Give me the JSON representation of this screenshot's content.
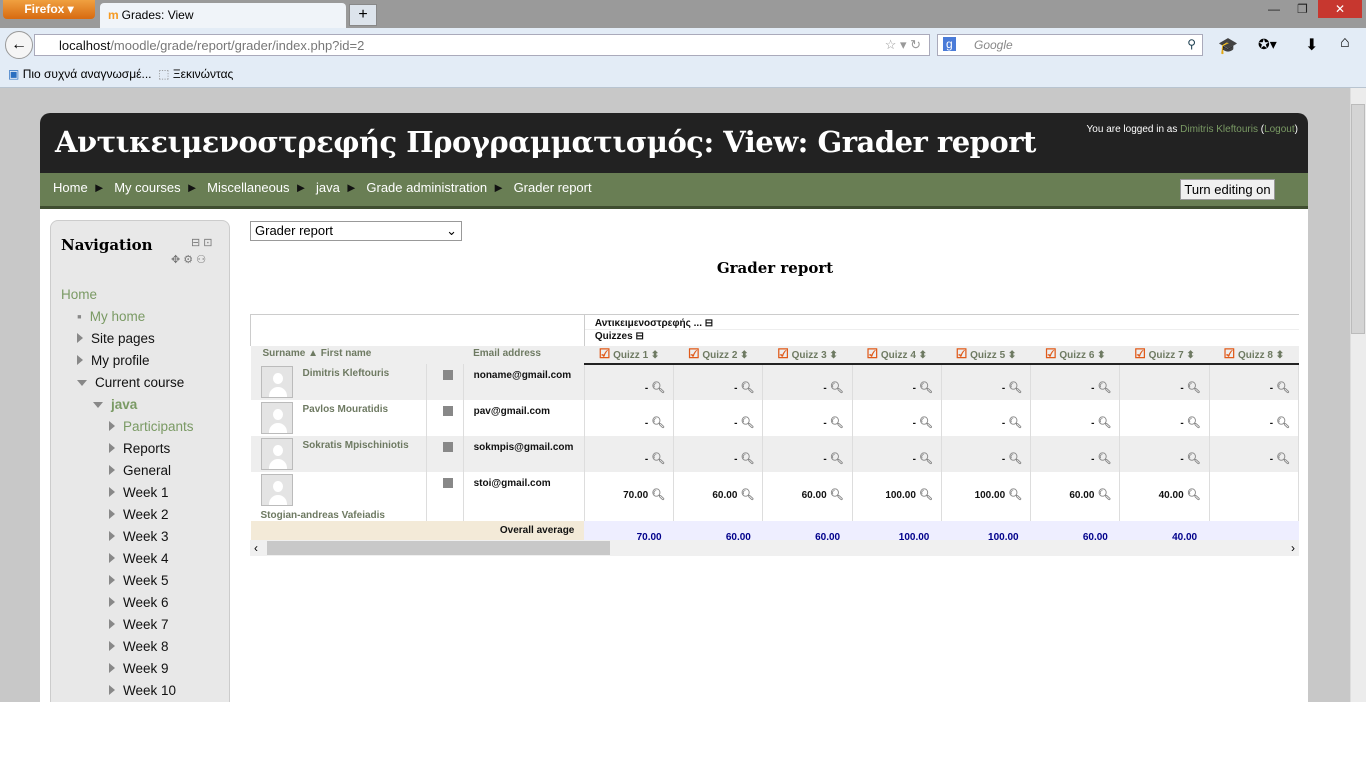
{
  "browser": {
    "menu_button": "Firefox",
    "tab_title": "Grades: View",
    "url_host": "localhost",
    "url_path": "/moodle/grade/report/grader/index.php?id=2",
    "search_placeholder": "Google",
    "bookmarks": [
      "Πιο συχνά αναγνωσμέ...",
      "Ξεκινώντας"
    ]
  },
  "header": {
    "title": "Αντικειμενοστρεφής Προγραμματισμός: View: Grader report",
    "login_prefix": "You are logged in as",
    "user": "Dimitris Kleftouris",
    "logout": "Logout"
  },
  "breadcrumb": [
    "Home",
    "My courses",
    "Miscellaneous",
    "java",
    "Grade administration",
    "Grader report"
  ],
  "edit_button": "Turn editing on",
  "navigation": {
    "title": "Navigation",
    "items": [
      {
        "label": "Home",
        "level": 0,
        "type": "link"
      },
      {
        "label": "My home",
        "level": 1,
        "type": "bullet"
      },
      {
        "label": "Site pages",
        "level": 1,
        "type": "collapsed"
      },
      {
        "label": "My profile",
        "level": 1,
        "type": "collapsed"
      },
      {
        "label": "Current course",
        "level": 1,
        "type": "expanded"
      },
      {
        "label": "java",
        "level": 2,
        "type": "expanded"
      },
      {
        "label": "Participants",
        "level": 3,
        "type": "collapsed"
      },
      {
        "label": "Reports",
        "level": 3,
        "type": "collapsed"
      },
      {
        "label": "General",
        "level": 3,
        "type": "collapsed"
      },
      {
        "label": "Week 1",
        "level": 3,
        "type": "collapsed"
      },
      {
        "label": "Week 2",
        "level": 3,
        "type": "collapsed"
      },
      {
        "label": "Week 3",
        "level": 3,
        "type": "collapsed"
      },
      {
        "label": "Week 4",
        "level": 3,
        "type": "collapsed"
      },
      {
        "label": "Week 5",
        "level": 3,
        "type": "collapsed"
      },
      {
        "label": "Week 6",
        "level": 3,
        "type": "collapsed"
      },
      {
        "label": "Week 7",
        "level": 3,
        "type": "collapsed"
      },
      {
        "label": "Week 8",
        "level": 3,
        "type": "collapsed"
      },
      {
        "label": "Week 9",
        "level": 3,
        "type": "collapsed"
      },
      {
        "label": "Week 10",
        "level": 3,
        "type": "collapsed"
      }
    ]
  },
  "report_select": "Grader report",
  "report_title": "Grader report",
  "grader": {
    "course_category": "Αντικειμενοστρεφής ...",
    "category": "Quizzes",
    "col_surname": "Surname",
    "col_firstname": "First name",
    "col_email": "Email address",
    "quizzes": [
      "Quizz 1",
      "Quizz 2",
      "Quizz 3",
      "Quizz 4",
      "Quizz 5",
      "Quizz 6",
      "Quizz 7",
      "Quizz 8"
    ],
    "students": [
      {
        "name": "Dimitris Kleftouris",
        "email": "noname@gmail.com",
        "grades": [
          "-",
          "-",
          "-",
          "-",
          "-",
          "-",
          "-",
          "-"
        ]
      },
      {
        "name": "Pavlos Mouratidis",
        "email": "pav@gmail.com",
        "grades": [
          "-",
          "-",
          "-",
          "-",
          "-",
          "-",
          "-",
          "-"
        ]
      },
      {
        "name": "Sokratis Mpischiniotis",
        "email": "sokmpis@gmail.com",
        "grades": [
          "-",
          "-",
          "-",
          "-",
          "-",
          "-",
          "-",
          "-"
        ]
      },
      {
        "name": "Stogian-andreas Vafeiadis",
        "email": "stoi@gmail.com",
        "grades": [
          "70.00",
          "60.00",
          "60.00",
          "100.00",
          "100.00",
          "60.00",
          "40.00",
          ""
        ]
      }
    ],
    "overall_label": "Overall average",
    "averages": [
      "70.00",
      "60.00",
      "60.00",
      "100.00",
      "100.00",
      "60.00",
      "40.00",
      ""
    ]
  }
}
